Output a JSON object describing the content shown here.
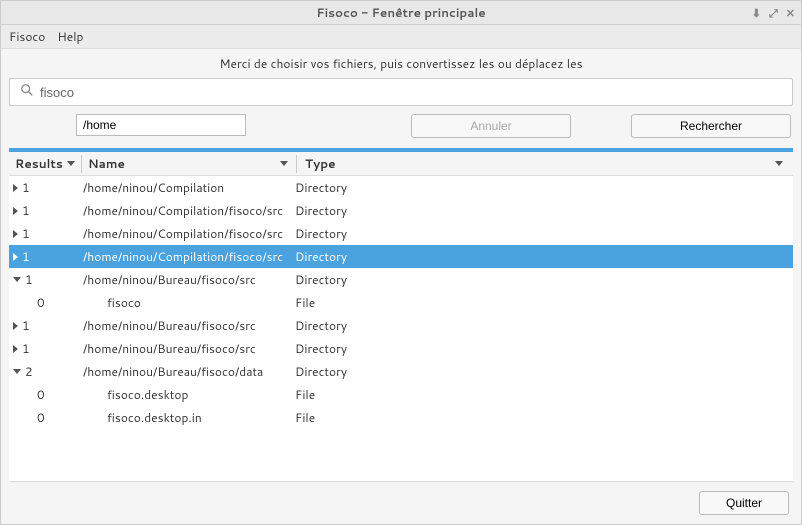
{
  "title": "Fisoco - Fenêtre principale",
  "menubar": {
    "fisoco": "Fisoco",
    "help": "Help"
  },
  "instruction": "Merci de choisir vos fichiers, puis convertissez les ou déplacez les",
  "search": {
    "value": "fisoco"
  },
  "path": {
    "value": "/home"
  },
  "buttons": {
    "cancel": "Annuler",
    "search": "Rechercher",
    "quit": "Quitter"
  },
  "headers": {
    "results": "Results",
    "name": "Name",
    "type": "Type"
  },
  "row0": {
    "r": "1",
    "n": "/home/ninou/Compilation",
    "t": "Directory"
  },
  "row1": {
    "r": "1",
    "n": "/home/ninou/Compilation/fisoco/src",
    "t": "Directory"
  },
  "row2": {
    "r": "1",
    "n": "/home/ninou/Compilation/fisoco/src",
    "t": "Directory"
  },
  "row3": {
    "r": "1",
    "n": "/home/ninou/Compilation/fisoco/src",
    "t": "Directory"
  },
  "row4": {
    "r": "1",
    "n": "/home/ninou/Bureau/fisoco/src",
    "t": "Directory"
  },
  "row5": {
    "r": "0",
    "n": "fisoco",
    "t": "File"
  },
  "row6": {
    "r": "1",
    "n": "/home/ninou/Bureau/fisoco/src",
    "t": "Directory"
  },
  "row7": {
    "r": "1",
    "n": "/home/ninou/Bureau/fisoco/src",
    "t": "Directory"
  },
  "row8": {
    "r": "2",
    "n": "/home/ninou/Bureau/fisoco/data",
    "t": "Directory"
  },
  "row9": {
    "r": "0",
    "n": "fisoco.desktop",
    "t": "File"
  },
  "row10": {
    "r": "0",
    "n": "fisoco.desktop.in",
    "t": "File"
  }
}
